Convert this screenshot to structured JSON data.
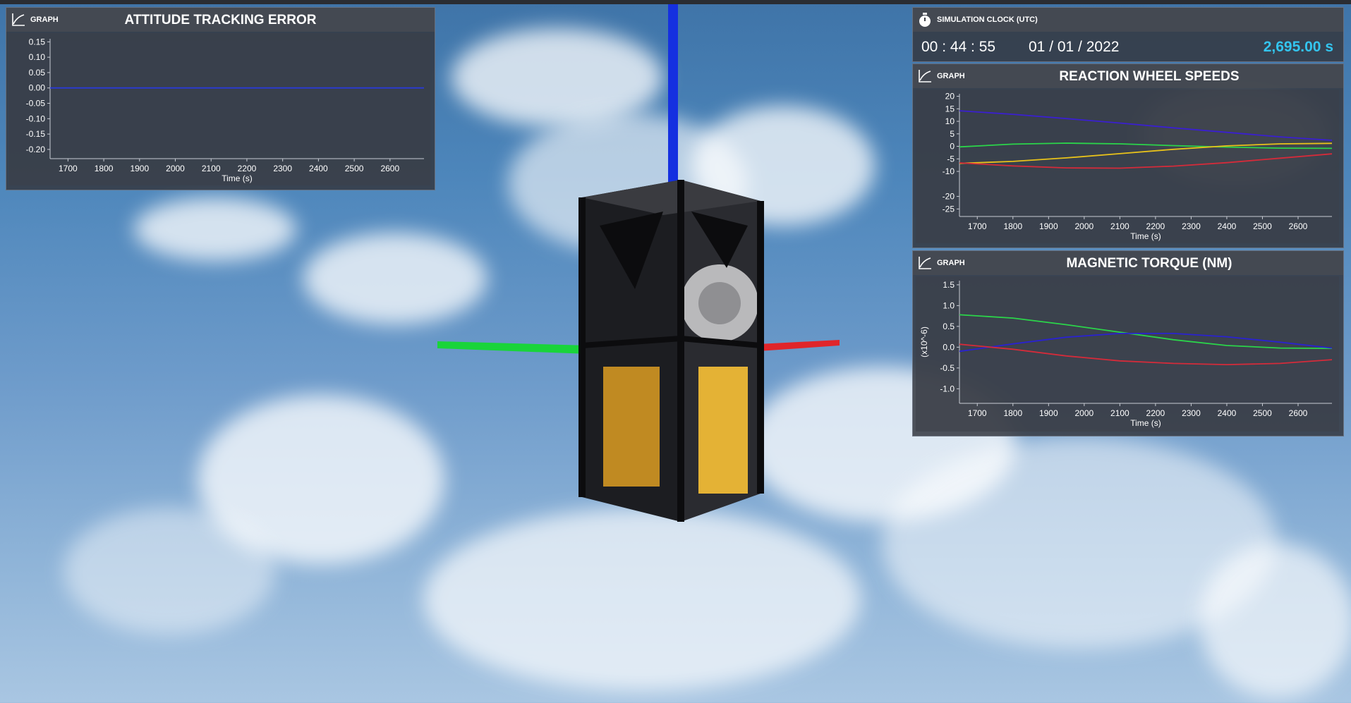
{
  "attitude_panel": {
    "tag": "GRAPH",
    "title": "ATTITUDE TRACKING ERROR"
  },
  "clock_panel": {
    "title": "SIMULATION CLOCK (UTC)",
    "time": "00 : 44 : 55",
    "date": "01 / 01 / 2022",
    "elapsed": "2,695.00 s",
    "accent_color": "#33c4ee"
  },
  "wheel_panel": {
    "tag": "GRAPH",
    "title": "REACTION WHEEL SPEEDS"
  },
  "torque_panel": {
    "tag": "GRAPH",
    "title": "MAGNETIC TORQUE (NM)"
  },
  "chart_data": [
    {
      "id": "attitude",
      "type": "line",
      "title": "ATTITUDE TRACKING ERROR",
      "xlabel": "Time (s)",
      "ylabel": "",
      "xlim": [
        1650,
        2695
      ],
      "ylim": [
        -0.23,
        0.16
      ],
      "xticks": [
        1700,
        1800,
        1900,
        2000,
        2100,
        2200,
        2300,
        2400,
        2500,
        2600
      ],
      "yticks": [
        0.15,
        0.1,
        0.05,
        0.0,
        -0.05,
        -0.1,
        -0.15,
        -0.2
      ],
      "ytick_labels": [
        "0.15",
        "0.10",
        "0.05",
        "0.00",
        "-0.05",
        "-0.10",
        "-0.15",
        "-0.20"
      ],
      "series": [
        {
          "color": "#2a3bd6",
          "x": [
            1650,
            2695
          ],
          "y": [
            0.0,
            0.0
          ]
        }
      ]
    },
    {
      "id": "wheels",
      "type": "line",
      "title": "REACTION WHEEL SPEEDS",
      "xlabel": "Time (s)",
      "ylabel": "",
      "xlim": [
        1650,
        2695
      ],
      "ylim": [
        -28,
        21
      ],
      "xticks": [
        1700,
        1800,
        1900,
        2000,
        2100,
        2200,
        2300,
        2400,
        2500,
        2600
      ],
      "yticks": [
        20,
        15,
        10,
        5,
        0,
        -5,
        -10,
        -20,
        -25
      ],
      "ytick_labels": [
        "20",
        "15",
        "10",
        "5",
        "0",
        "-5",
        "-10",
        "-20",
        "-25"
      ],
      "series": [
        {
          "color": "#3a1fd0",
          "x": [
            1650,
            1800,
            1950,
            2100,
            2250,
            2400,
            2550,
            2695
          ],
          "y": [
            14.2,
            12.8,
            11.1,
            9.3,
            7.4,
            5.6,
            3.8,
            2.4
          ]
        },
        {
          "color": "#2bd44a",
          "x": [
            1650,
            1800,
            1950,
            2100,
            2250,
            2400,
            2550,
            2695
          ],
          "y": [
            -0.2,
            0.9,
            1.3,
            1.0,
            0.3,
            -0.3,
            -0.7,
            -0.8
          ]
        },
        {
          "color": "#e8c21a",
          "x": [
            1650,
            1800,
            1950,
            2100,
            2250,
            2400,
            2550,
            2695
          ],
          "y": [
            -6.8,
            -6.0,
            -4.6,
            -2.9,
            -1.2,
            0.2,
            1.0,
            1.2
          ]
        },
        {
          "color": "#d42b3a",
          "x": [
            1650,
            1800,
            1950,
            2100,
            2250,
            2400,
            2550,
            2695
          ],
          "y": [
            -6.6,
            -7.8,
            -8.6,
            -8.7,
            -7.9,
            -6.5,
            -4.7,
            -3.0
          ]
        }
      ]
    },
    {
      "id": "torque",
      "type": "line",
      "title": "MAGNETIC TORQUE (NM)",
      "xlabel": "Time (s)",
      "ylabel": "(x10^-6)",
      "xlim": [
        1650,
        2695
      ],
      "ylim": [
        -1.35,
        1.6
      ],
      "xticks": [
        1700,
        1800,
        1900,
        2000,
        2100,
        2200,
        2300,
        2400,
        2500,
        2600
      ],
      "yticks": [
        1.5,
        1.0,
        0.5,
        0.0,
        -0.5,
        -1.0
      ],
      "ytick_labels": [
        "1.5",
        "1.0",
        "0.5",
        "0.0",
        "-0.5",
        "-1.0"
      ],
      "series": [
        {
          "color": "#2bd44a",
          "x": [
            1650,
            1800,
            1950,
            2100,
            2250,
            2400,
            2550,
            2695
          ],
          "y": [
            0.78,
            0.7,
            0.54,
            0.36,
            0.18,
            0.04,
            -0.02,
            -0.03
          ]
        },
        {
          "color": "#2a22d0",
          "x": [
            1650,
            1800,
            1950,
            2100,
            2250,
            2400,
            2550,
            2695
          ],
          "y": [
            -0.1,
            0.08,
            0.24,
            0.33,
            0.33,
            0.25,
            0.12,
            -0.02
          ]
        },
        {
          "color": "#d42b3a",
          "x": [
            1650,
            1800,
            1950,
            2100,
            2250,
            2400,
            2550,
            2695
          ],
          "y": [
            0.07,
            -0.05,
            -0.21,
            -0.33,
            -0.39,
            -0.42,
            -0.39,
            -0.3
          ]
        }
      ]
    }
  ]
}
